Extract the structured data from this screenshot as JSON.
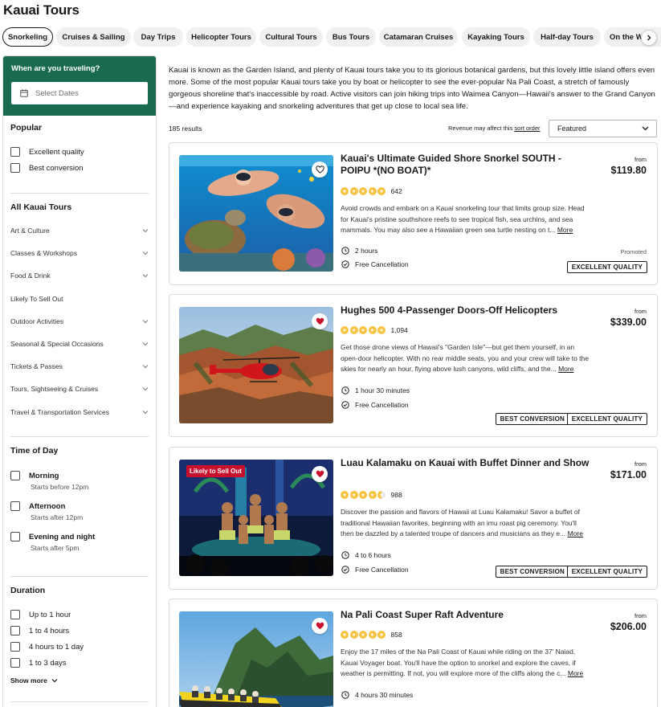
{
  "page": {
    "title": "Kauai Tours"
  },
  "chips": [
    {
      "label": "Snorkeling",
      "active": true
    },
    {
      "label": "Cruises & Sailing"
    },
    {
      "label": "Day Trips"
    },
    {
      "label": "Helicopter Tours"
    },
    {
      "label": "Cultural Tours"
    },
    {
      "label": "Bus Tours"
    },
    {
      "label": "Catamaran Cruises"
    },
    {
      "label": "Kayaking Tours"
    },
    {
      "label": "Half-day Tours"
    },
    {
      "label": "On the Wa"
    }
  ],
  "sidebar": {
    "date_title": "When are you traveling?",
    "date_placeholder": "Select Dates",
    "popular": {
      "heading": "Popular",
      "items": [
        "Excellent quality",
        "Best conversion"
      ]
    },
    "all_tours": {
      "heading": "All Kauai Tours",
      "items": [
        {
          "label": "Art & Culture",
          "expandable": true
        },
        {
          "label": "Classes & Workshops",
          "expandable": true
        },
        {
          "label": "Food & Drink",
          "expandable": true
        },
        {
          "label": "Likely To Sell Out",
          "expandable": false
        },
        {
          "label": "Outdoor Activities",
          "expandable": true
        },
        {
          "label": "Seasonal & Special Occasions",
          "expandable": true
        },
        {
          "label": "Tickets & Passes",
          "expandable": true
        },
        {
          "label": "Tours, Sightseeing & Cruises",
          "expandable": true
        },
        {
          "label": "Travel & Transportation Services",
          "expandable": true
        }
      ]
    },
    "time_of_day": {
      "heading": "Time of Day",
      "items": [
        {
          "label": "Morning",
          "sub": "Starts before 12pm"
        },
        {
          "label": "Afternoon",
          "sub": "Starts after 12pm"
        },
        {
          "label": "Evening and night",
          "sub": "Starts after 5pm"
        }
      ]
    },
    "duration": {
      "heading": "Duration",
      "items": [
        "Up to 1 hour",
        "1 to 4 hours",
        "4 hours to 1 day",
        "1 to 3 days"
      ],
      "show_more": "Show more"
    }
  },
  "main": {
    "intro": "Kauai is known as the Garden Island, and plenty of Kauai tours take you to its glorious botanical gardens, but this lovely little island offers even more. Some of the most popular Kauai tours take you by boat or helicopter to see the ever-popular Na Pali Coast, a stretch of famously gorgeous shoreline that's inaccessible by road. Active visitors can join hiking trips into Waimea Canyon—Hawaii's answer to the Grand Canyon—and experience kayaking and snorkeling adventures that get up close to local sea life.",
    "results": "185 results",
    "revenue_prefix": "Revenue may affect this",
    "revenue_link": "sort order",
    "sort_value": "Featured"
  },
  "cards": [
    {
      "title": "Kauai's Ultimate Guided Shore Snorkel SOUTH - POIPU *(NO BOAT)*",
      "rating": 5,
      "reviews": "642",
      "desc": "Avoid crowds and embark on a Kauai snorkeling tour that limits group size. Head for Kauai's pristine southshore reefs to see tropical fish, sea urchins, and sea mammals. You may also see a Hawaiian green sea turtle nesting on t...",
      "more": "More",
      "duration": "2 hours",
      "cancellation": "Free Cancellation",
      "from": "from",
      "price": "$119.80",
      "promoted": "Promoted",
      "tags": [
        "EXCELLENT QUALITY"
      ],
      "liked": false,
      "badge": ""
    },
    {
      "title": "Hughes 500 4-Passenger Doors-Off Helicopters",
      "rating": 5,
      "reviews": "1,094",
      "desc": "Get those drone views of Hawaii's \"Garden Isle\"—but get them yourself, in an open-door helicopter. With no rear middle seats, you and your crew will take to the skies for nearly an hour, flying above lush canyons, wild cliffs, and the...",
      "more": "More",
      "duration": "1 hour 30 minutes",
      "cancellation": "Free Cancellation",
      "from": "from",
      "price": "$339.00",
      "tags": [
        "BEST CONVERSION",
        "EXCELLENT QUALITY"
      ],
      "liked": true,
      "badge": ""
    },
    {
      "title": "Luau Kalamaku on Kauai with Buffet Dinner and Show",
      "rating": 4.5,
      "reviews": "988",
      "desc": "Discover the passion and flavors of Hawaii at Luau Kalamaku! Savor a buffet of traditional Hawaiian favorites, beginning with an imu roast pig ceremony. You'll then be dazzled by a talented troupe of dancers and musicians as they e...",
      "more": "More",
      "duration": "4 to 6 hours",
      "cancellation": "Free Cancellation",
      "from": "from",
      "price": "$171.00",
      "tags": [
        "BEST CONVERSION",
        "EXCELLENT QUALITY"
      ],
      "liked": true,
      "badge": "Likely to Sell Out"
    },
    {
      "title": "Na Pali Coast Super Raft Adventure",
      "rating": 5,
      "reviews": "858",
      "desc": "Enjoy the 17 miles of the Na Pali Coast of Kauai while riding on the 37' Naiad, Kauai Voyager boat. You'll have the option to snorkel and explore the caves, if weather is permitting. If not, you will explore more of the cliffs along the c...",
      "more": "More",
      "duration": "4 hours 30 minutes",
      "from": "from",
      "price": "$206.00",
      "tags": [],
      "liked": true,
      "badge": ""
    }
  ],
  "colors": {
    "accent_green": "#186b4c",
    "heart_red": "#c8102e",
    "star": "#f6c343"
  }
}
